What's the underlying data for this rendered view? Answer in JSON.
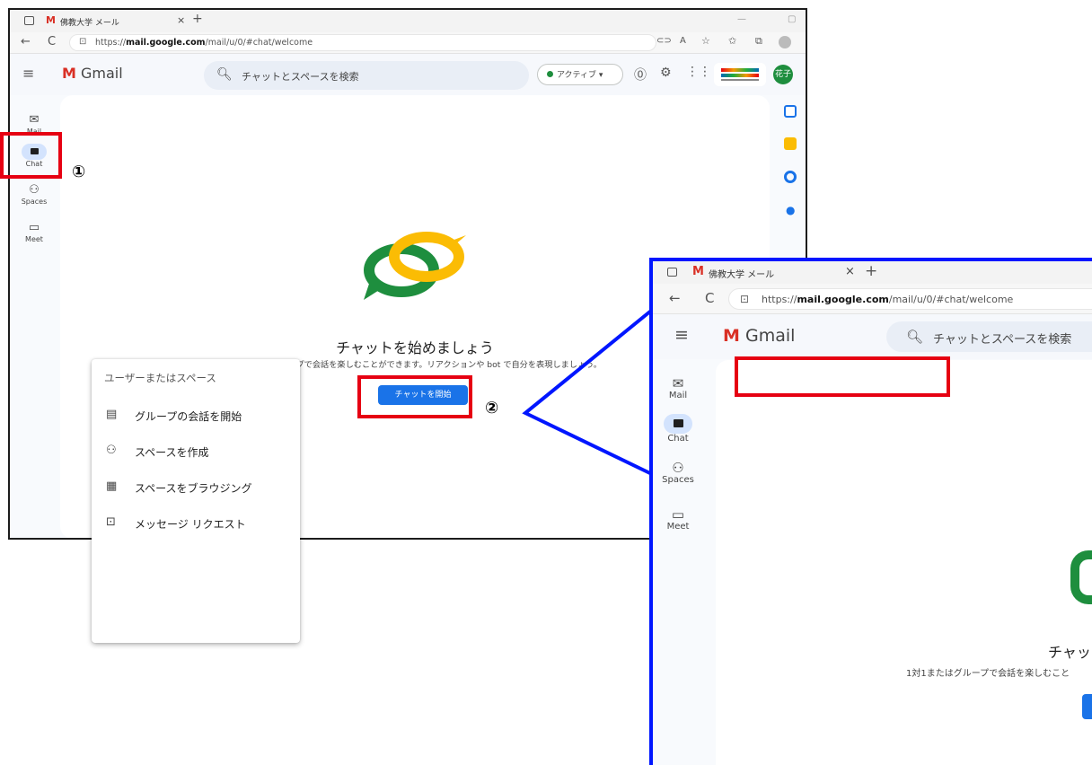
{
  "browser": {
    "tab_title": "佛教大学 メール",
    "tab_close": "×",
    "tab_new": "+",
    "url_prefix": "https://",
    "url_domain": "mail.google.com",
    "url_path": "/mail/u/0/#chat/welcome",
    "back_glyph": "←",
    "reload_glyph": "C",
    "minimize_glyph": "—",
    "restore_glyph": "▢"
  },
  "gmail": {
    "logo_text": "Gmail",
    "search_placeholder": "チャットとスペースを検索",
    "status_label": "アクティブ",
    "status_caret": "▾",
    "avatar_text": "花子"
  },
  "sidebar": {
    "items": [
      {
        "label": "Mail",
        "icon": "mail-icon"
      },
      {
        "label": "Chat",
        "icon": "chat-icon"
      },
      {
        "label": "Spaces",
        "icon": "spaces-icon"
      },
      {
        "label": "Meet",
        "icon": "meet-icon"
      }
    ]
  },
  "welcome": {
    "title": "チャットを始めましょう",
    "subtitle": "1対1またはグループで会話を楽しむことができます。リアクションや bot で自分を表現しましょう。",
    "start_button": "チャットを開始"
  },
  "annotations": {
    "step1": "①",
    "step2": "②"
  },
  "menu": {
    "input_placeholder": "ユーザーまたはスペース",
    "items": [
      {
        "label": "グループの会話を開始",
        "icon": "group-chat-icon"
      },
      {
        "label": "スペースを作成",
        "icon": "create-space-icon"
      },
      {
        "label": "スペースをブラウジング",
        "icon": "browse-spaces-icon"
      },
      {
        "label": "メッセージ リクエスト",
        "icon": "message-request-icon"
      }
    ]
  },
  "inset_partial": {
    "title_fragment": "チャッ",
    "subtitle_fragment": "1対1またはグループで会話を楽しむこと"
  },
  "colors": {
    "annotation_red": "#e60012",
    "inset_border_blue": "#0016ff",
    "button_blue": "#1a73e8",
    "active_green": "#1e8e3e"
  }
}
